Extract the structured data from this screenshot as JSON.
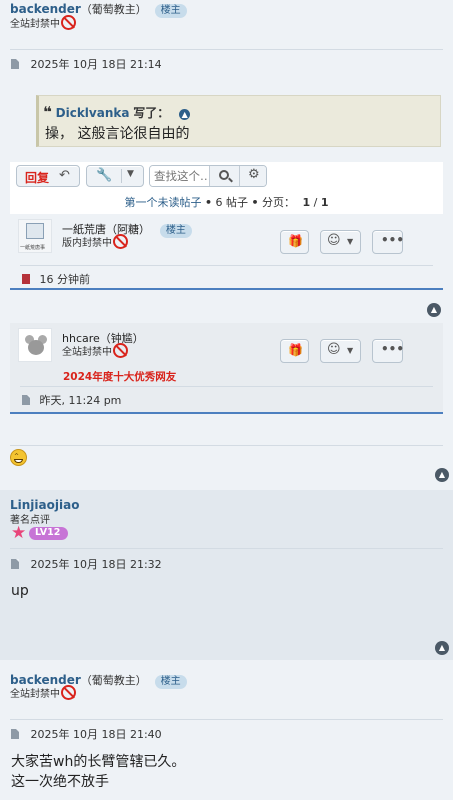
{
  "post1": {
    "username": "backender",
    "nickname": "（葡萄教主）",
    "badge": "楼主",
    "status": "全站封禁中",
    "date": "2025年 10月 18日 21:14"
  },
  "quote": {
    "author": "Dicklvanka",
    "wrote": "写了：",
    "text": "操，  这般言论很自由的"
  },
  "toolbar": {
    "reply_label": "回复",
    "search_placeholder": "查找这个…",
    "first_unread": "第一个未读帖子",
    "post_count": "6 帖子",
    "page_label": "分页：",
    "page_current": "1",
    "page_total": "1"
  },
  "preview1": {
    "username": "一紙荒唐（阿糖）",
    "badge": "楼主",
    "status": "版内封禁中",
    "avatar_text": "一紙荒唐事",
    "time": "16 分钟前"
  },
  "preview2": {
    "username": "hhcare（钟尴）",
    "status": "全站封禁中",
    "award": "2024年度十大优秀网友",
    "time": "昨天, 11:24 pm"
  },
  "post2": {
    "username": "Linjiaojiao",
    "rank": "著名点评",
    "level": "LV12",
    "date": "2025年 10月 18日 21:32",
    "body": "up"
  },
  "post3": {
    "username": "backender",
    "nickname": "（葡萄教主）",
    "badge": "楼主",
    "status": "全站封禁中",
    "date": "2025年 10月 18日 21:40",
    "body_line1": "大家苦wh的长臂管辖已久。",
    "body_line2": "这一次绝不放手"
  },
  "colors": {
    "username": "#2d5f8a",
    "award": "#d9241c",
    "accent_rule": "#4c7fbf"
  }
}
